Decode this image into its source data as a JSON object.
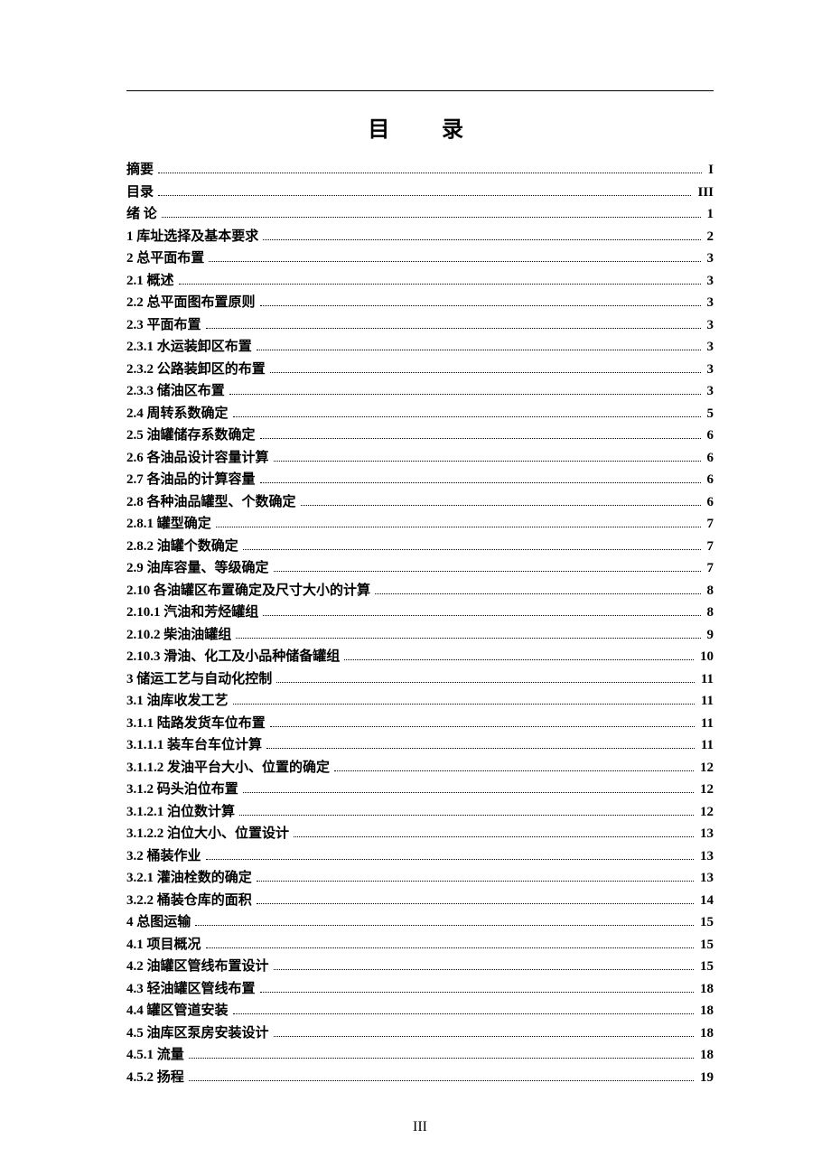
{
  "title_left": "目",
  "title_right": "录",
  "footer_page": "III",
  "toc": [
    {
      "label": "摘要",
      "page": "I"
    },
    {
      "label": "目录",
      "page": "III"
    },
    {
      "label": "绪  论",
      "page": "1"
    },
    {
      "label": "1  库址选择及基本要求",
      "page": "2"
    },
    {
      "label": "2  总平面布置",
      "page": "3"
    },
    {
      "label": "2.1  概述",
      "page": "3"
    },
    {
      "label": "2.2  总平面图布置原则",
      "page": "3"
    },
    {
      "label": "2.3  平面布置",
      "page": "3"
    },
    {
      "label": "2.3.1  水运装卸区布置",
      "page": "3"
    },
    {
      "label": "2.3.2  公路装卸区的布置",
      "page": "3"
    },
    {
      "label": "2.3.3  储油区布置",
      "page": "3"
    },
    {
      "label": "2.4  周转系数确定",
      "page": "5"
    },
    {
      "label": "2.5  油罐储存系数确定",
      "page": "6"
    },
    {
      "label": "2.6  各油品设计容量计算",
      "page": "6"
    },
    {
      "label": "2.7  各油品的计算容量",
      "page": "6"
    },
    {
      "label": "2.8  各种油品罐型、个数确定",
      "page": "6"
    },
    {
      "label": "2.8.1 罐型确定",
      "page": "7"
    },
    {
      "label": "2.8.2  油罐个数确定",
      "page": "7"
    },
    {
      "label": "2.9  油库容量、等级确定",
      "page": "7"
    },
    {
      "label": "2.10  各油罐区布置确定及尺寸大小的计算",
      "page": "8"
    },
    {
      "label": "2.10.1  汽油和芳烃罐组",
      "page": "8"
    },
    {
      "label": "2.10.2  柴油油罐组",
      "page": "9"
    },
    {
      "label": "2.10.3  滑油、化工及小品种储备罐组",
      "page": "10"
    },
    {
      "label": "3  储运工艺与自动化控制",
      "page": "11"
    },
    {
      "label": "3.1 油库收发工艺",
      "page": "11"
    },
    {
      "label": "3.1.1  陆路发货车位布置",
      "page": "11"
    },
    {
      "label": "3.1.1.1  装车台车位计算",
      "page": "11"
    },
    {
      "label": "3.1.1.2  发油平台大小、位置的确定",
      "page": "12"
    },
    {
      "label": "3.1.2  码头泊位布置",
      "page": "12"
    },
    {
      "label": "3.1.2.1  泊位数计算",
      "page": "12"
    },
    {
      "label": "3.1.2.2  泊位大小、位置设计",
      "page": "13"
    },
    {
      "label": "3.2  桶装作业",
      "page": "13"
    },
    {
      "label": "3.2.1  灌油栓数的确定",
      "page": "13"
    },
    {
      "label": "3.2.2  桶装仓库的面积",
      "page": "14"
    },
    {
      "label": "4 总图运输",
      "page": "15"
    },
    {
      "label": "4.1  项目概况",
      "page": "15"
    },
    {
      "label": "4.2    油罐区管线布置设计",
      "page": "15"
    },
    {
      "label": "4.3    轻油罐区管线布置",
      "page": "18"
    },
    {
      "label": "4.4    罐区管道安装",
      "page": "18"
    },
    {
      "label": "4.5    油库区泵房安装设计",
      "page": "18"
    },
    {
      "label": "4.5.1 流量",
      "page": "18"
    },
    {
      "label": "4.5.2 扬程",
      "page": "19"
    }
  ]
}
